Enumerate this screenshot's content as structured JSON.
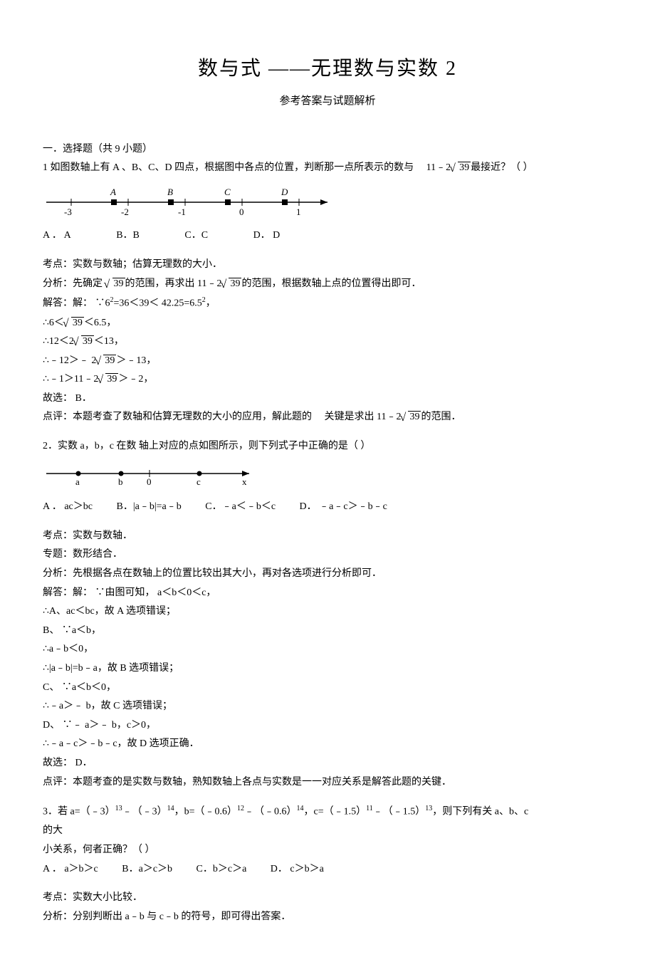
{
  "title": "数与式 ——无理数与实数  2",
  "subtitle": "参考答案与试题解析",
  "section1": "一．选择题（共  9 小题）",
  "q1": {
    "stem_a": "1 如图数轴上有  A 、B、C、D 四点，根据图中各点的位置，判断那一点所表示的数与",
    "stem_b": "11﹣2",
    "stem_c": "最接近？（        ）",
    "optA": "A ．  A",
    "optB": "B．B",
    "optC": "C．C",
    "optD": "D．    D",
    "kd": "考点：实数与数轴；估算无理数的大小．",
    "fx_a": "分析：先确定 ",
    "fx_b": "的范围，再求出  11﹣2",
    "fx_c": "的范围，根据数轴上点的位置得出即可．",
    "jda": "解答：解：  ∵6",
    "jdb": "=36＜39＜ 42.25=6.5",
    "jdc": "，",
    "l1a": "∴6＜",
    "l1b": "＜6.5，",
    "l2a": "∴12＜2",
    "l2b": "＜13，",
    "l3a": "∴﹣12＞﹣ 2",
    "l3b": "＞﹣13，",
    "l4a": "∴﹣1＞11﹣2",
    "l4b": "＞﹣2，",
    "gx": "故选：  B．",
    "dp_a": "点评：本题考查了数轴和估算无理数的大小的应用，解此题的",
    "dp_b": "关键是求出  11﹣2",
    "dp_c": "的范围．",
    "sqrt": "39"
  },
  "q2": {
    "stem": "2．实数  a，b，c 在数 轴上对应的点如图所示，则下列式子中正确的是（            ）",
    "optA": "A ．  ac＞bc",
    "optB": "B．|a﹣b|=a﹣b",
    "optC": "C．﹣a＜﹣b＜c",
    "optD": "D．    ﹣a﹣c＞﹣b﹣c",
    "kd": "考点：实数与数轴．",
    "zt": "专题：数形结合．",
    "fx": "分析：先根据各点在数轴上的位置比较出其大小，再对各选项进行分析即可．",
    "jd": "解答：解：  ∵由图可知，  a＜b＜0＜c，",
    "la": "∴A、ac＜bc，故  A 选项错误；",
    "lb1": "B、 ∵a＜b，",
    "lb2": "∴a﹣b＜0，",
    "lb3": "∴|a﹣b|=b﹣a，故  B 选项错误；",
    "lc1": "C、 ∵a＜b＜0，",
    "lc2": "∴﹣a＞﹣ b，故  C 选项错误；",
    "ld1": "D、 ∵﹣ a＞﹣ b，c＞0，",
    "ld2": "∴﹣a﹣c＞﹣b﹣c，故  D 选项正确．",
    "gx": "故选：  D．",
    "dp": "点评：本题考查的是实数与数轴，熟知数轴上各点与实数是一一对应关系是解答此题的关键．"
  },
  "q3": {
    "stem_a": "3．若  a=（﹣3）",
    "e1": "13",
    "stem_b": "﹣（﹣3）",
    "e2": "14",
    "stem_c": "，b=（﹣0.6）",
    "e3": "12",
    "stem_d": "﹣（﹣0.6）",
    "e4": "14",
    "stem_e": "，c=（﹣1.5）",
    "e5": "11",
    "stem_f": "﹣（﹣1.5）",
    "e6": "13",
    "stem_g": "，则下列有关  a、b、c",
    "stem_h": "的大",
    "stem_i": "小关系，何者正确？（        ）",
    "optA": "A ．  a＞b＞c",
    "optB": "B．a＞c＞b",
    "optC": "C．b＞c＞a",
    "optD": "D．    c＞b＞a",
    "kd": "考点：实数大小比较．",
    "fx": "分析：分别判断出  a﹣b 与 c﹣b 的符号，即可得出答案．"
  }
}
